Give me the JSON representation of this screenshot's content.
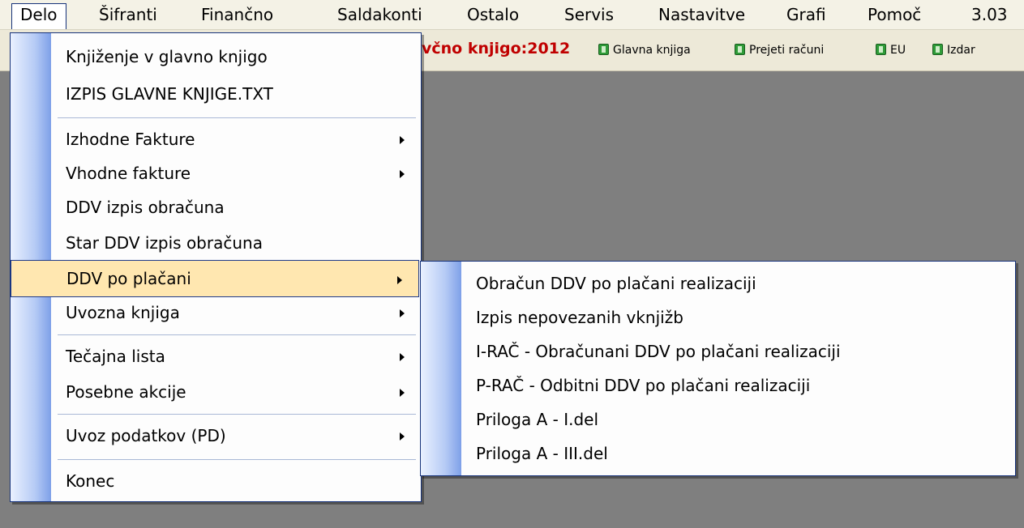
{
  "menubar": {
    "items": [
      "Delo",
      "Šifranti",
      "Finančno",
      "Saldakonti",
      "Ostalo",
      "Servis",
      "Nastavitve",
      "Grafi",
      "Pomoč",
      "3.03"
    ]
  },
  "toolbar": {
    "title": "včno knjigo:2012",
    "buttons": [
      "Glavna knjiga",
      "Prejeti računi",
      "EU",
      "Izdar"
    ]
  },
  "delo_menu": {
    "items": [
      {
        "label": "Knjiženje v glavno knjigo",
        "submenu": false
      },
      {
        "label": "IZPIS GLAVNE KNJIGE.TXT",
        "submenu": false
      },
      {
        "label": "Izhodne Fakture",
        "submenu": true
      },
      {
        "label": "Vhodne fakture",
        "submenu": true
      },
      {
        "label": "DDV izpis obračuna",
        "submenu": false
      },
      {
        "label": "Star DDV izpis obračuna",
        "submenu": false
      },
      {
        "label": "DDV po plačani",
        "submenu": true,
        "highlighted": true
      },
      {
        "label": "Uvozna knjiga",
        "submenu": true
      },
      {
        "label": "Tečajna lista",
        "submenu": true
      },
      {
        "label": "Posebne akcije",
        "submenu": true
      },
      {
        "label": "Uvoz podatkov (PD)",
        "submenu": true
      },
      {
        "label": "Konec",
        "submenu": false
      }
    ]
  },
  "ddv_submenu": {
    "items": [
      "Obračun DDV po plačani realizaciji",
      "Izpis nepovezanih vknjižb",
      "I-RAČ - Obračunani DDV po plačani realizaciji",
      "P-RAČ - Odbitni DDV po plačani realizaciji",
      "Priloga A - I.del",
      "Priloga A - III.del"
    ]
  },
  "colors": {
    "highlight": "#ffe7b0",
    "title_red": "#c00000",
    "menu_border": "#16327a"
  }
}
